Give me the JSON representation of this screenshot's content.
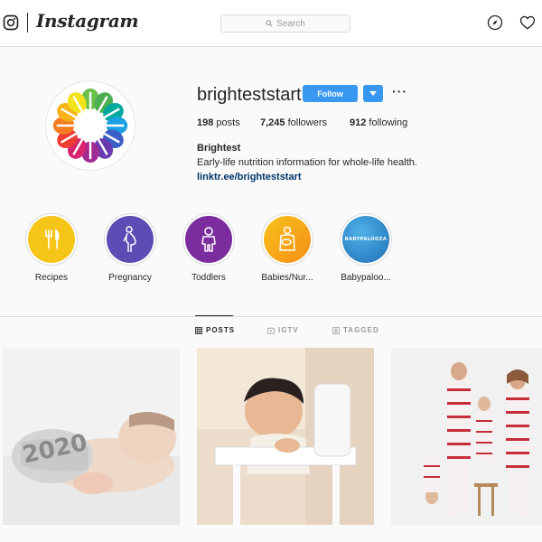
{
  "nav": {
    "wordmark": "Instagram",
    "search_placeholder": "Search",
    "icons": [
      "instagram-glyph-icon",
      "search-icon",
      "compass-icon",
      "heart-icon"
    ]
  },
  "profile": {
    "username": "brighteststart",
    "follow_label": "Follow",
    "more_label": "···",
    "posts_count": "198",
    "posts_label": " posts",
    "followers_count": "7,245",
    "followers_label": " followers",
    "following_count": "912",
    "following_label": " following",
    "full_name": "Brightest",
    "bio": "Early-life nutrition information for whole-life health.",
    "link": "linktr.ee/brighteststart"
  },
  "highlights": [
    {
      "label": "Recipes",
      "icon": "fork-knife-icon",
      "color": "#f5c518"
    },
    {
      "label": "Pregnancy",
      "icon": "pregnant-person-icon",
      "color": "#5b4db3"
    },
    {
      "label": "Toddlers",
      "icon": "child-icon",
      "color": "#7b2d9e"
    },
    {
      "label": "Babies/Nur...",
      "icon": "nursing-icon",
      "color": "#f5a418"
    },
    {
      "label": "Babypaloo...",
      "icon": "babypalooza-logo",
      "color": "#2e86c9",
      "logo_text": "BABYPALOOZA"
    }
  ],
  "tabs": [
    {
      "label": "POSTS",
      "icon": "grid-icon",
      "active": true
    },
    {
      "label": "IGTV",
      "icon": "igtv-icon",
      "active": false
    },
    {
      "label": "TAGGED",
      "icon": "tag-icon",
      "active": false
    }
  ],
  "posts": [
    {
      "subject": "newborn-2020-photo",
      "overlay_text": "2020"
    },
    {
      "subject": "toddler-highchair-photo"
    },
    {
      "subject": "family-pajamas-photo"
    }
  ],
  "colors": {
    "accent": "#3897f0",
    "link": "#003569",
    "border": "#dbdbdb",
    "background": "#fafafa"
  }
}
